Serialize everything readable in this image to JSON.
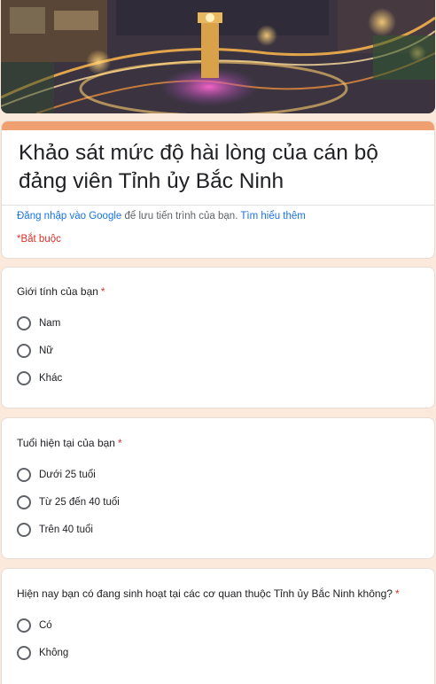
{
  "header": {
    "banner_icon": "night-roundabout-photo"
  },
  "form": {
    "title": "Khảo sát mức độ hài lòng của cán bộ đảng viên Tỉnh ủy Bắc Ninh",
    "signin_link": "Đăng nhập vào Google",
    "signin_text": " để lưu tiến trình của bạn. ",
    "learn_more": "Tìm hiểu thêm",
    "required_note": "*Bắt buộc"
  },
  "questions": [
    {
      "title": "Giới tính của bạn",
      "required_mark": "*",
      "options": [
        "Nam",
        "Nữ",
        "Khác"
      ]
    },
    {
      "title": "Tuổi hiện tại của bạn",
      "required_mark": "*",
      "options": [
        "Dưới 25 tuổi",
        "Từ 25 đến 40 tuổi",
        "Trên 40 tuổi"
      ]
    },
    {
      "title": "Hiện nay bạn có đang sinh hoạt tại các cơ quan thuộc Tỉnh ủy Bắc Ninh không?",
      "required_mark": "*",
      "options": [
        "Có",
        "Không"
      ]
    }
  ],
  "colors": {
    "page_bg": "#fbe9dc",
    "accent": "#f0a070",
    "required": "#d93025",
    "link": "#1a73e8"
  }
}
